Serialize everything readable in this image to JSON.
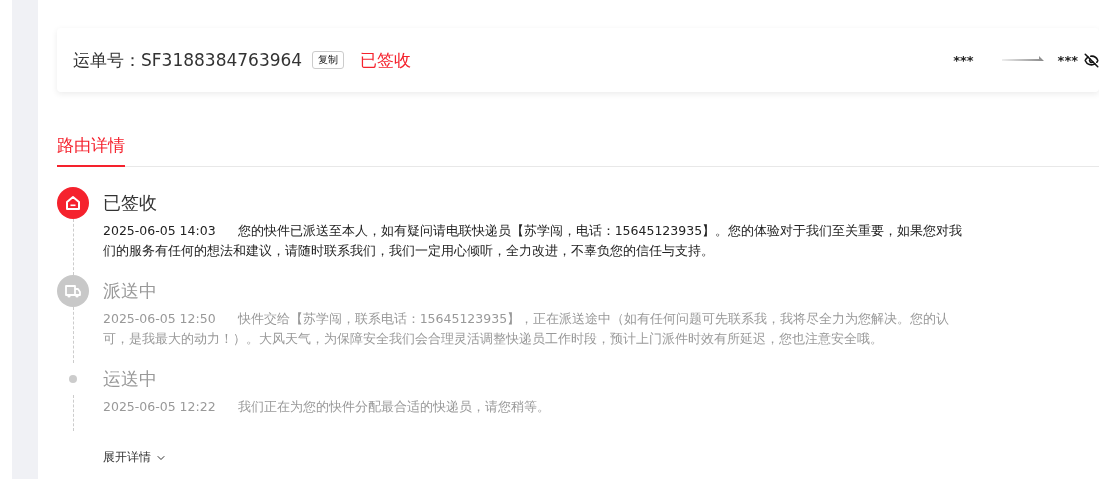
{
  "waybill": {
    "label": "运单号：",
    "number": "SF3188384763964",
    "copy_button": "复制",
    "status": "已签收",
    "origin": "***",
    "destination": "***"
  },
  "tabs": [
    {
      "label": "路由详情",
      "selected": true
    }
  ],
  "timeline": [
    {
      "kind": "signed",
      "active": true,
      "title": "已签收",
      "time": "2025-06-05 14:03",
      "text": "您的快件已派送至本人，如有疑问请电联快递员【苏学闯，电话：15645123935】。您的体验对于我们至关重要，如果您对我们的服务有任何的想法和建议，请随时联系我们，我们一定用心倾听，全力改进，不辜负您的信任与支持。"
    },
    {
      "kind": "delivering",
      "active": false,
      "title": "派送中",
      "time": "2025-06-05 12:50",
      "text": "快件交给【苏学闯，联系电话：15645123935】，正在派送途中（如有任何问题可先联系我，我将尽全力为您解决。您的认可，是我最大的动力！）。大风天气，为保障安全我们会合理灵活调整快递员工作时段，预计上门派件时效有所延迟，您也注意安全哦。"
    },
    {
      "kind": "transit",
      "active": false,
      "title": "运送中",
      "time": "2025-06-05 12:22",
      "text": "我们正在为您的快件分配最合适的快递员，请您稍等。"
    }
  ],
  "expand_link": "展开详情"
}
